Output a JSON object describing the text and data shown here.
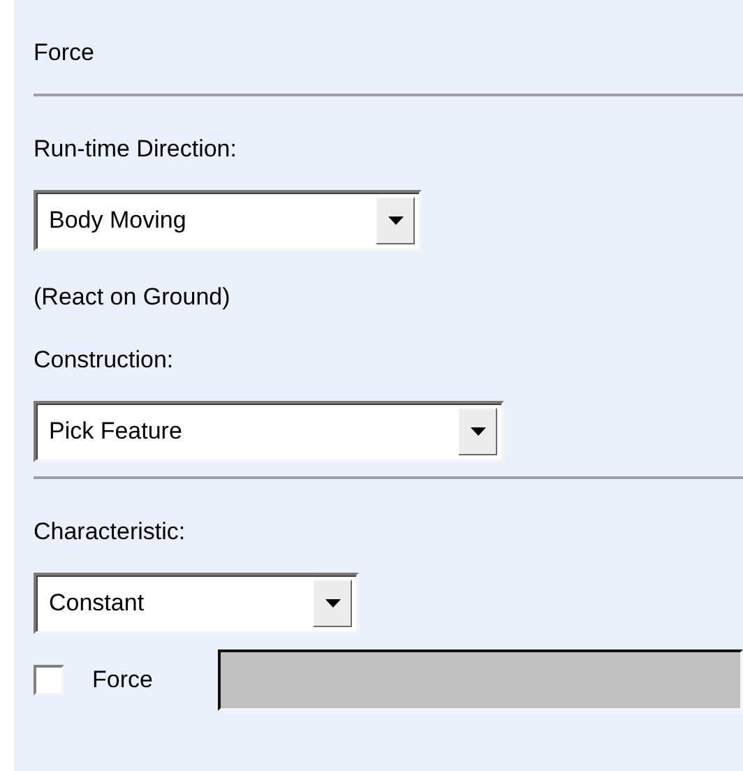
{
  "panel": {
    "title": "Force",
    "rows": [
      {
        "kind": "rule"
      },
      {
        "kind": "label",
        "text": "Run-time Direction:"
      },
      {
        "kind": "dropdown",
        "value": "Body Moving"
      },
      {
        "kind": "note",
        "text": "(React on Ground)"
      },
      {
        "kind": "label",
        "text": "Construction:"
      },
      {
        "kind": "dropdown",
        "value": "Pick Feature"
      },
      {
        "kind": "rule"
      },
      {
        "kind": "label",
        "text": "Characteristic:"
      },
      {
        "kind": "dropdown",
        "value": "Constant"
      },
      {
        "kind": "checkbox",
        "label": "Force",
        "checked": false,
        "field_disabled": true
      }
    ]
  }
}
